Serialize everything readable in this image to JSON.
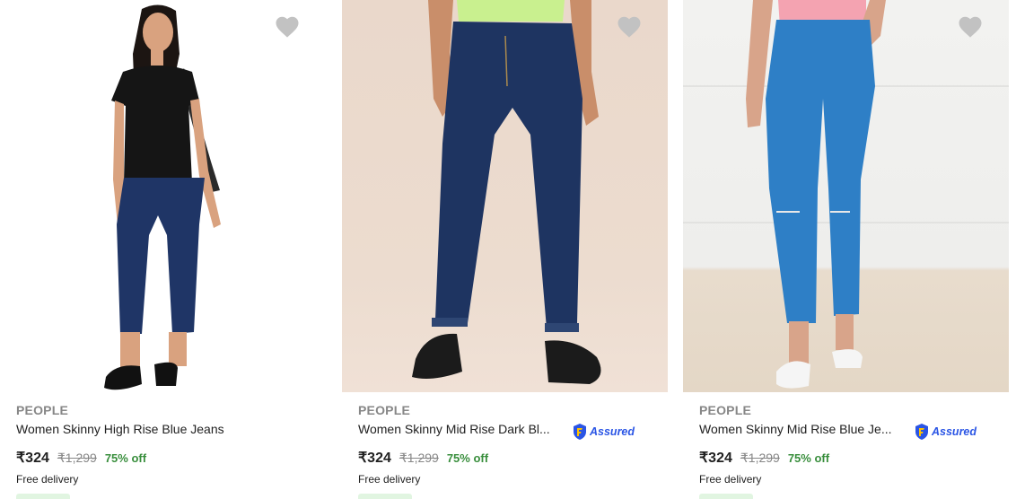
{
  "products": [
    {
      "brand": "PEOPLE",
      "title": "Women Skinny High Rise Blue Jeans",
      "price": "₹324",
      "mrp": "₹1,299",
      "discount": "75% off",
      "delivery": "Free delivery",
      "assured": false,
      "wishlist_icon": "heart-icon"
    },
    {
      "brand": "PEOPLE",
      "title": "Women Skinny Mid Rise Dark Bl...",
      "price": "₹324",
      "mrp": "₹1,299",
      "discount": "75% off",
      "delivery": "Free delivery",
      "assured": true,
      "assured_label": "Assured",
      "wishlist_icon": "heart-icon"
    },
    {
      "brand": "PEOPLE",
      "title": "Women Skinny Mid Rise Blue Je...",
      "price": "₹324",
      "mrp": "₹1,299",
      "discount": "75% off",
      "delivery": "Free delivery",
      "assured": true,
      "assured_label": "Assured",
      "wishlist_icon": "heart-icon"
    }
  ],
  "colors": {
    "brand_text": "#878787",
    "discount": "#388e3c",
    "assured": "#2a55e5",
    "wishlist_heart": "#c2c2c2"
  }
}
